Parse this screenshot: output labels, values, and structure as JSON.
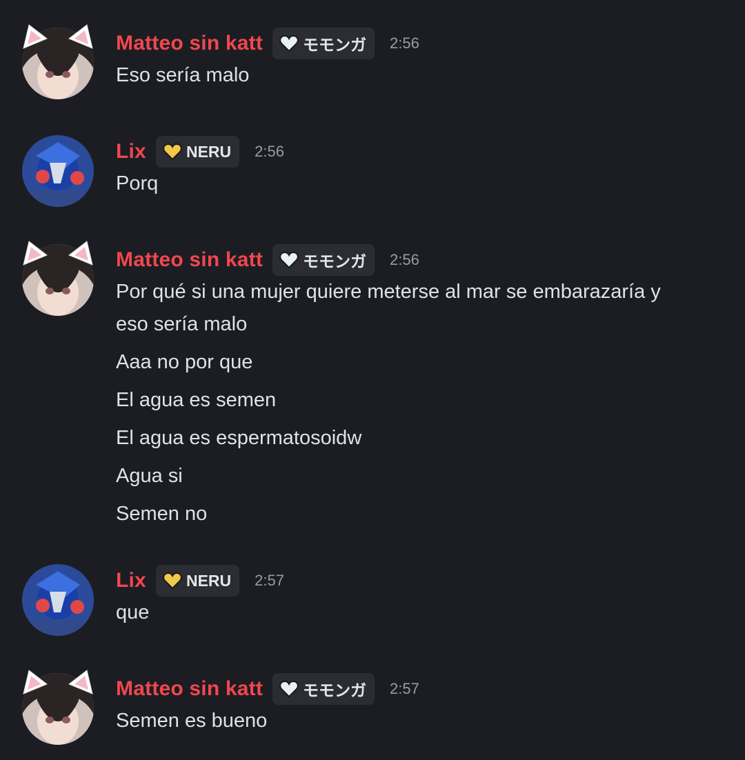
{
  "messages": [
    {
      "author": "Matteo sin katt",
      "tag": "モモンガ",
      "tag_icon": "white-heart-icon",
      "time": "2:56",
      "lines": [
        "Eso sería malo"
      ]
    },
    {
      "author": "Lix",
      "tag": "NERU",
      "tag_icon": "gold-heart-icon",
      "time": "2:56",
      "lines": [
        "Porq"
      ]
    },
    {
      "author": "Matteo sin katt",
      "tag": "モモンガ",
      "tag_icon": "white-heart-icon",
      "time": "2:56",
      "lines": [
        "Por qué si una mujer quiere meterse al mar se embarazaría y",
        "eso sería malo",
        "Aaa no por que",
        "El agua es semen",
        "El agua es espermatosoidw",
        "Agua si",
        "Semen no"
      ]
    },
    {
      "author": "Lix",
      "tag": "NERU",
      "tag_icon": "gold-heart-icon",
      "time": "2:57",
      "lines": [
        "que"
      ]
    },
    {
      "author": "Matteo sin katt",
      "tag": "モモンガ",
      "tag_icon": "white-heart-icon",
      "time": "2:57",
      "lines": [
        "Semen es bueno"
      ]
    }
  ],
  "colors": {
    "background": "#1c1d22",
    "username": "#f0474f",
    "tag_bg": "#2b2d33",
    "timestamp": "#9a9ca3"
  }
}
